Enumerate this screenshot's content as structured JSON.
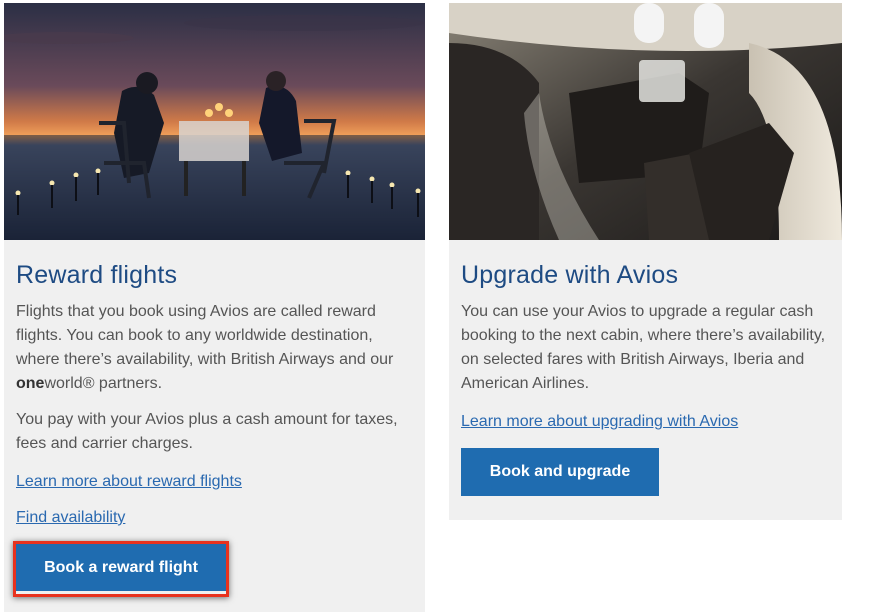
{
  "colors": {
    "title": "#1e4b83",
    "link": "#2a69b0",
    "button": "#1f6cb0",
    "card_bg": "#f0f0f0",
    "highlight": "#e8321e"
  },
  "reward_card": {
    "title": "Reward flights",
    "para1_part1": "Flights that you book using Avios are called reward flights. You can book to any worldwide destination, where there’s availability, with British Airways and our ",
    "para1_brand": "one",
    "para1_part2": "world® partners.",
    "para2": "You pay with your Avios plus a cash amount for taxes, fees and carrier charges.",
    "learn_more_link": "Learn more about reward flights",
    "find_availability_link": "Find availability",
    "button_label": "Book a reward flight"
  },
  "upgrade_card": {
    "title": "Upgrade with Avios",
    "para1": "You can use your Avios to upgrade a regular cash booking to the next cabin, where there’s availability, on selected fares with British Airways, Iberia and American Airlines.",
    "learn_more_link": "Learn more about upgrading with Avios",
    "button_label": "Book and upgrade"
  }
}
